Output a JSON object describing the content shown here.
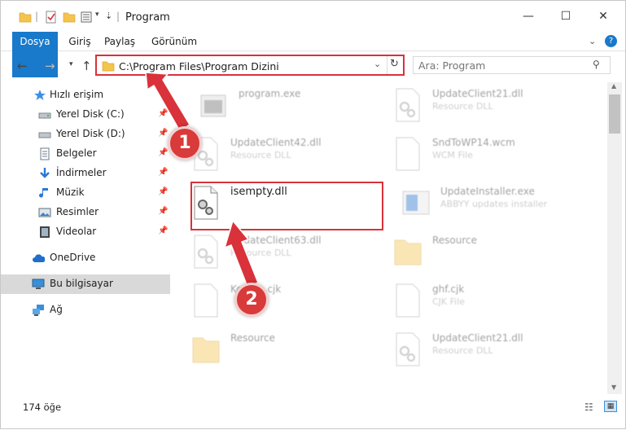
{
  "window": {
    "title": "Program",
    "controls": [
      "minimize",
      "maximize",
      "close"
    ]
  },
  "ribbon": {
    "tabs": [
      {
        "label": "Dosya",
        "active": true
      },
      {
        "label": "Giriş"
      },
      {
        "label": "Paylaş"
      },
      {
        "label": "Görünüm"
      }
    ]
  },
  "address": {
    "path": "C:\\Program Files\\Program Dizini",
    "search_placeholder": "Ara: Program"
  },
  "nav": {
    "items": [
      {
        "label": "Hızlı erişim",
        "icon": "star-icon"
      },
      {
        "label": "Yerel Disk (C:)",
        "icon": "drive-icon",
        "pinned": true
      },
      {
        "label": "Yerel Disk (D:)",
        "icon": "drive-icon",
        "pinned": true
      },
      {
        "label": "Belgeler",
        "icon": "documents-icon",
        "pinned": true
      },
      {
        "label": "İndirmeler",
        "icon": "download-icon",
        "pinned": true
      },
      {
        "label": "Müzik",
        "icon": "music-icon",
        "pinned": true
      },
      {
        "label": "Resimler",
        "icon": "pictures-icon",
        "pinned": true
      },
      {
        "label": "Videolar",
        "icon": "videos-icon",
        "pinned": true
      },
      {
        "label": "OneDrive",
        "icon": "cloud-icon"
      },
      {
        "label": "Bu bilgisayar",
        "icon": "computer-icon",
        "selected": true
      },
      {
        "label": "Ağ",
        "icon": "network-icon"
      }
    ]
  },
  "files": [
    {
      "name": "program.exe",
      "type": "",
      "icon": "exe-icon"
    },
    {
      "name": "UpdateClient21.dll",
      "type": "Resource DLL",
      "icon": "dll-icon"
    },
    {
      "name": "UpdateClient42.dll",
      "type": "Resource DLL",
      "icon": "dll-icon"
    },
    {
      "name": "SndToWP14.wcm",
      "type": "WCM File",
      "icon": "file-icon"
    },
    {
      "name": "isempty.dll",
      "type": "",
      "icon": "dll-icon"
    },
    {
      "name": "UpdateInstaller.exe",
      "type": "ABBYY updates installer",
      "icon": "installer-icon"
    },
    {
      "name": "UpdateClient63.dll",
      "type": "Resource DLL",
      "icon": "dll-icon"
    },
    {
      "name": "Resource",
      "type": "",
      "icon": "folder-icon"
    },
    {
      "name": "Korean.cjk",
      "type": "",
      "icon": "file-icon"
    },
    {
      "name": "ghf.cjk",
      "type": "CJK File",
      "icon": "file-icon"
    },
    {
      "name": "Resource",
      "type": "",
      "icon": "folder-icon"
    },
    {
      "name": "UpdateClient21.dll",
      "type": "Resource DLL",
      "icon": "dll-icon"
    }
  ],
  "status": {
    "count": "174 öğe"
  },
  "annotations": {
    "step1": "1",
    "step2": "2",
    "highlight_color": "#d9323a"
  },
  "colors": {
    "accent": "#1979ca",
    "highlight": "#d9323a"
  }
}
